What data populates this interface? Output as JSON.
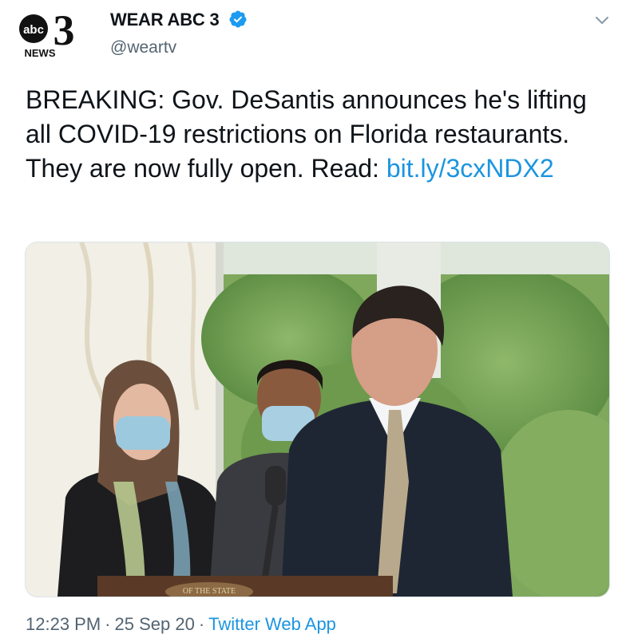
{
  "tweet": {
    "author": {
      "display_name": "WEAR ABC 3",
      "handle": "@weartv",
      "verified": true,
      "avatar_logo_text": "abc",
      "avatar_logo_number": "3",
      "avatar_logo_subtext": "NEWS"
    },
    "text": "BREAKING: Gov. DeSantis announces he's lifting all COVID-19 restrictions on Florida restaurants. They are now fully open. Read: ",
    "link": "bit.ly/3cxNDX2",
    "media_seal_text": "OF THE STATE",
    "time": "12:23 PM",
    "date": "25 Sep 20",
    "separator": "·",
    "source": "Twitter Web App"
  },
  "icons": {
    "verified": "verified-badge-icon",
    "menu": "chevron-down-icon"
  },
  "colors": {
    "link": "#1b95e0",
    "secondary_text": "#536471",
    "verified": "#1d9bf0"
  }
}
